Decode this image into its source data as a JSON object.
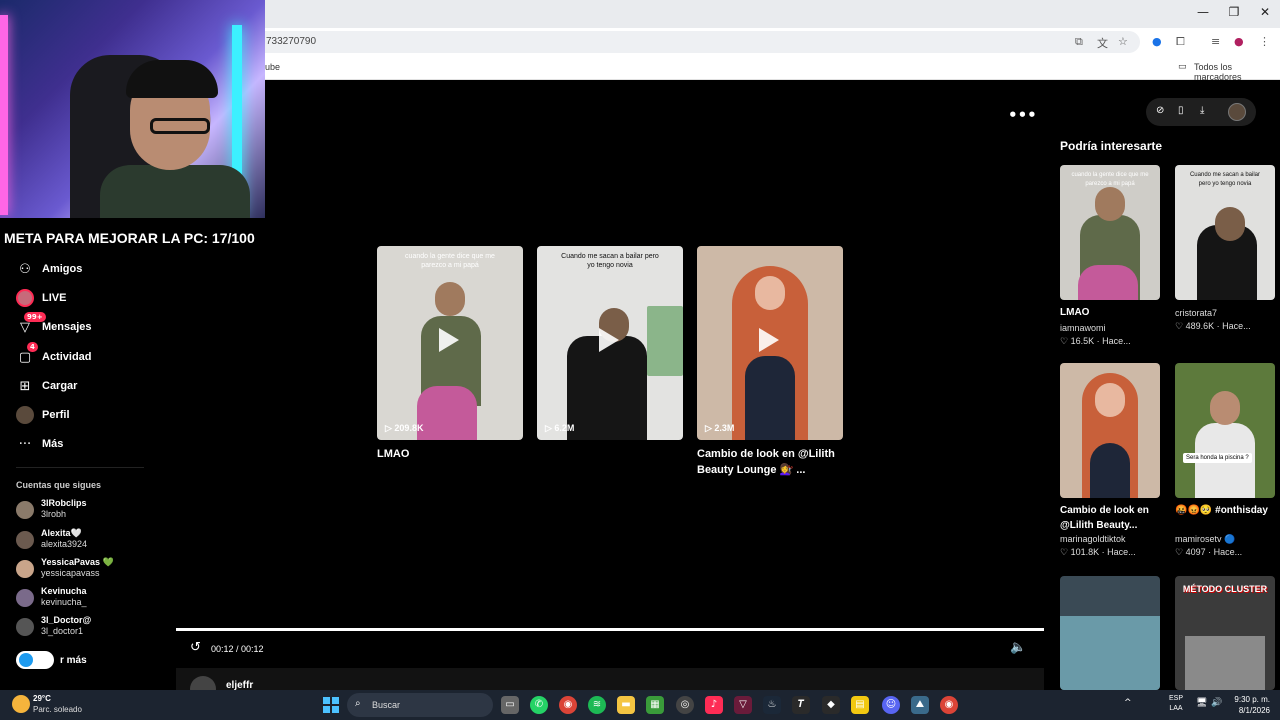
{
  "browser": {
    "url_fragment": "733270790",
    "bookmark_fragment": "ube",
    "all_bookmarks_label": "Todos los marcadores",
    "win_min": "—",
    "win_max": "❐",
    "win_close": "✕"
  },
  "overlay": {
    "goal_text": "META PARA MEJORAR LA PC: 17/100"
  },
  "sidebar": {
    "items": [
      {
        "label": "Amigos",
        "icon": "friends-icon",
        "glyph": "👥"
      },
      {
        "label": "LIVE",
        "icon": "live-icon",
        "glyph": ""
      },
      {
        "label": "Mensajes",
        "icon": "messages-icon",
        "glyph": "✉",
        "badge": "99+"
      },
      {
        "label": "Actividad",
        "icon": "activity-icon",
        "glyph": "☐",
        "badge": "4"
      },
      {
        "label": "Cargar",
        "icon": "upload-icon",
        "glyph": "⊞"
      },
      {
        "label": "Perfil",
        "icon": "profile-icon",
        "glyph": ""
      },
      {
        "label": "Más",
        "icon": "more-icon",
        "glyph": "···"
      }
    ],
    "following_title": "Cuentas que sigues",
    "following": [
      {
        "name": "3lRobclips",
        "handle": "3lrobh",
        "avatar_color": "#8a7a6a"
      },
      {
        "name": "Alexita🤍",
        "handle": "alexita3924",
        "avatar_color": "#6b5a4f"
      },
      {
        "name": "YessicaPavas 💚",
        "handle": "yessicapavass",
        "avatar_color": "#c9a58a"
      },
      {
        "name": "Kevinucha",
        "handle": "kevinucha_",
        "avatar_color": "#7a6a8a"
      },
      {
        "name": "3l_Doctor@",
        "handle": "3l_doctor1",
        "avatar_color": "#555555"
      }
    ],
    "see_more_label": "r más"
  },
  "videos": [
    {
      "caption": "cuando la gente dice que me parezco a mi papá",
      "views": "209.8K",
      "title": "LMAO",
      "bg": "#d9d7d2"
    },
    {
      "caption": "Cuando me sacan a bailar pero yo tengo novia",
      "views": "6.2M",
      "title": "",
      "bg": "#e3e3e1"
    },
    {
      "caption": "",
      "views": "2.3M",
      "title": "Cambio de look en @Lilith Beauty Lounge 💇‍♀️ ...",
      "bg": "#cdb9a7"
    }
  ],
  "player": {
    "time": "00:12 / 00:12",
    "progress": 1.0,
    "author": "eljeffr",
    "more_glyph": "•••"
  },
  "recommendations": {
    "heading": "Podría interesarte",
    "items": [
      {
        "title": "LMAO",
        "author": "iamnawomi",
        "likes": "♡ 16.5K · Hace...",
        "bg": "#cfcdc8",
        "caption": "cuando la gente dice que me parezco a mi papá"
      },
      {
        "title": "",
        "author": "cristorata7",
        "likes": "♡ 489.6K · Hace...",
        "bg": "#e0e0de",
        "caption": "Cuando me sacan a bailar pero yo tengo novia"
      },
      {
        "title": "Cambio de look en @Lilith Beauty...",
        "author": "marinagoldtiktok",
        "likes": "♡ 101.8K · Hace...",
        "bg": "#cdb9a7",
        "caption": ""
      },
      {
        "title": "🤬😡🥺 #onthisday",
        "author": "mamirosetv 🔵",
        "likes": "♡ 4097 · Hace...",
        "bg": "#5d7a3c",
        "caption": "Sera honda la piscina ?"
      },
      {
        "title": "",
        "author": "",
        "likes": "",
        "bg": "#3a4a55",
        "caption": ""
      },
      {
        "title": "",
        "author": "",
        "likes": "",
        "bg": "#3b3b3b",
        "caption": "MÉTODO CLUSTER"
      }
    ]
  },
  "taskbar": {
    "temp": "29°C",
    "condition": "Parc. soleado",
    "search_label": "Buscar",
    "lang_line1": "ESP",
    "lang_line2": "LAA",
    "time": "9:30 p. m.",
    "date": "8/1/2026"
  }
}
